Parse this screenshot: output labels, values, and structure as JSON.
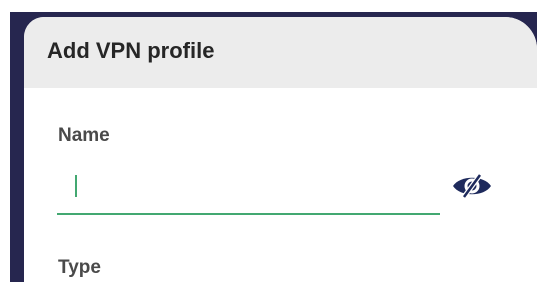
{
  "dialog": {
    "title": "Add VPN profile"
  },
  "fields": {
    "name": {
      "label": "Name",
      "value": "",
      "placeholder": ""
    },
    "type": {
      "label": "Type"
    }
  },
  "icons": {
    "visibility_toggle": "eye-off-icon"
  },
  "colors": {
    "accent": "#43a871",
    "icon": "#1e2a5c",
    "header_background": "#ececec",
    "backdrop": "#26264f",
    "title_text": "#262626",
    "label_text": "#4a4a4a"
  }
}
